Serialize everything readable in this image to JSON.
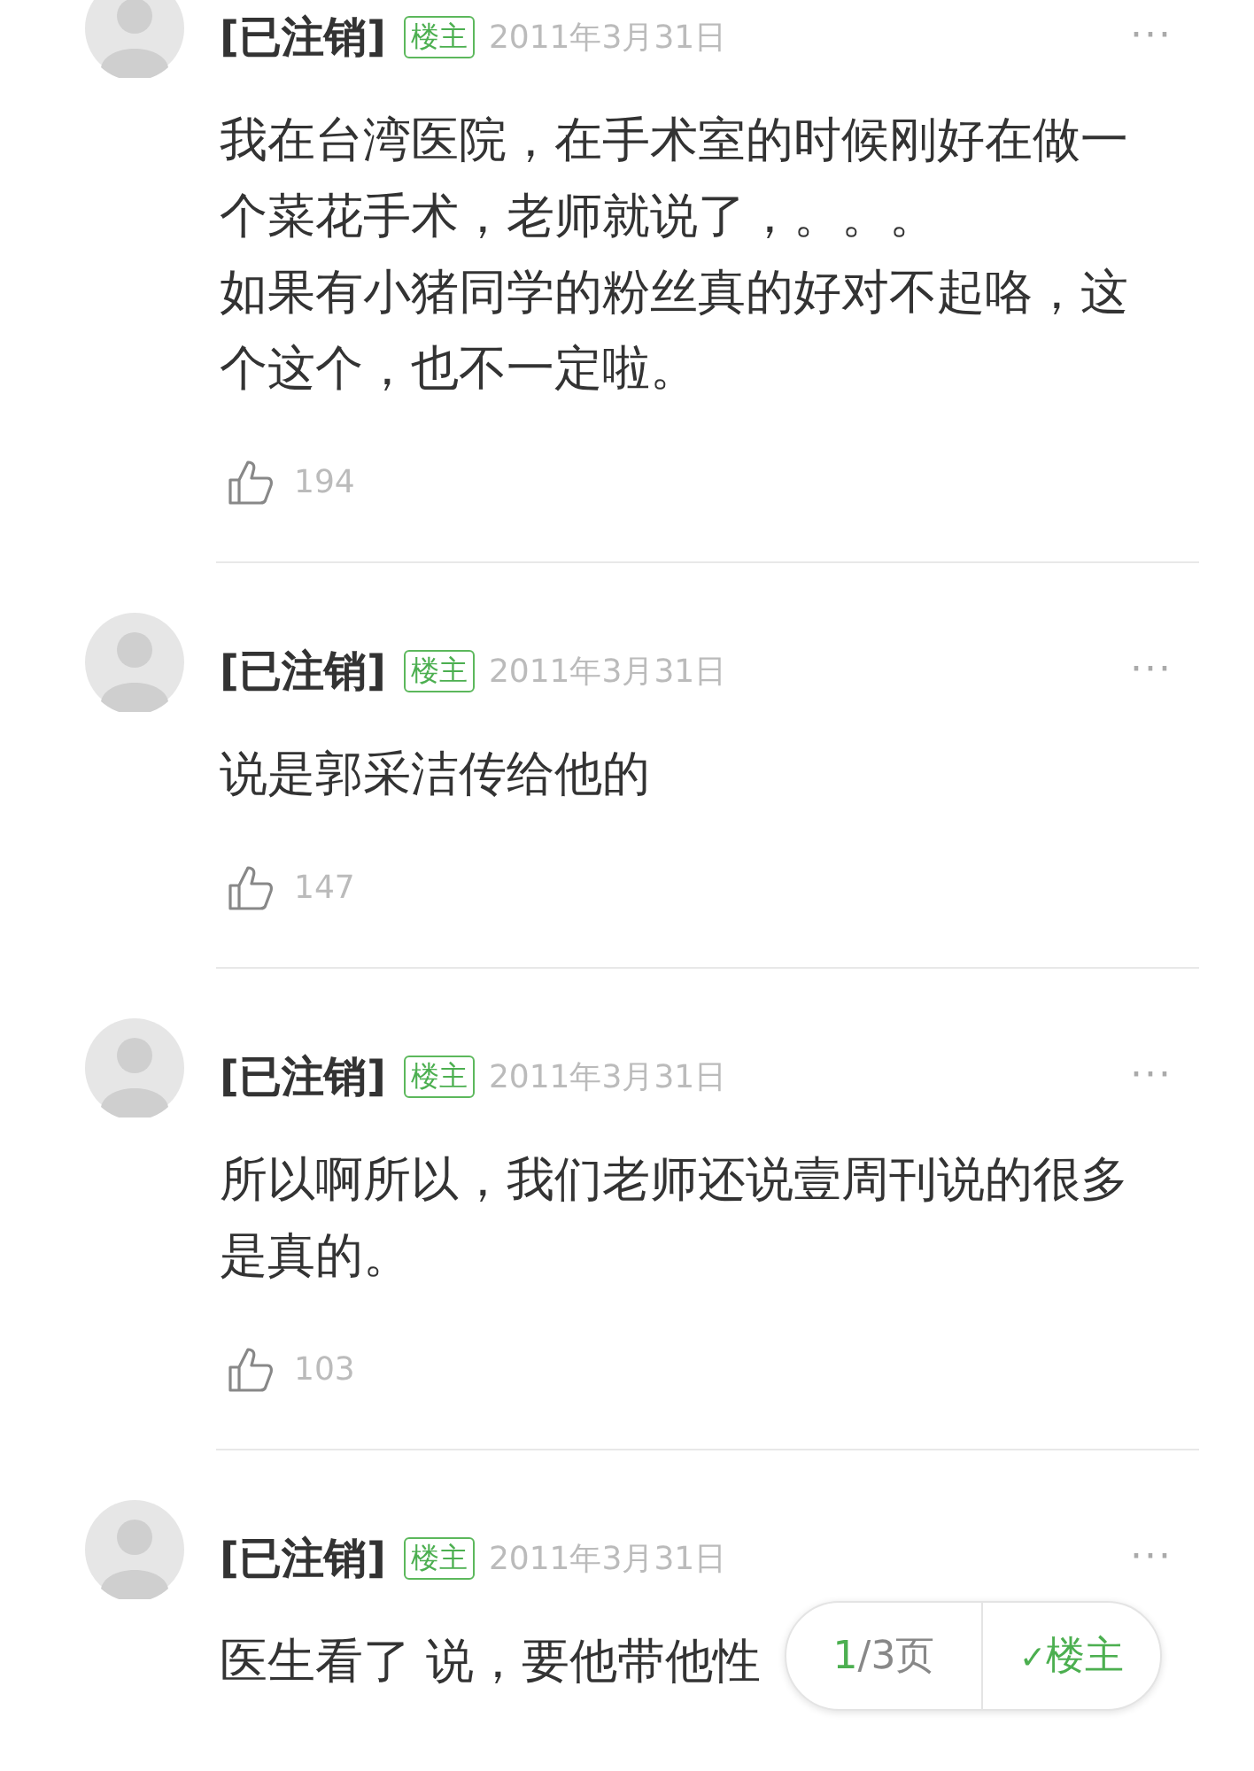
{
  "posts": [
    {
      "author": "[已注销]",
      "badge": "楼主",
      "date": "2011年3月31日",
      "more": "···",
      "lines": [
        "我在台湾医院，在手术室的时候刚好在做一个菜花手术，老师就说了，。。。",
        "如果有小猪同学的粉丝真的好对不起咯，这个这个，也不一定啦。"
      ],
      "likes": "194"
    },
    {
      "author": "[已注销]",
      "badge": "楼主",
      "date": "2011年3月31日",
      "more": "···",
      "lines": [
        "说是郭采洁传给他的"
      ],
      "likes": "147"
    },
    {
      "author": "[已注销]",
      "badge": "楼主",
      "date": "2011年3月31日",
      "more": "···",
      "lines": [
        "所以啊所以，我们老师还说壹周刊说的很多是真的。"
      ],
      "likes": "103"
    },
    {
      "author": "[已注销]",
      "badge": "楼主",
      "date": "2011年3月31日",
      "more": "···",
      "lines": [
        "医生看了 说，要他带他性"
      ]
    }
  ],
  "pager": {
    "current": "1",
    "total": "/3页",
    "filter_check": "✓",
    "filter_label": "楼主",
    "filter_selected": true
  }
}
